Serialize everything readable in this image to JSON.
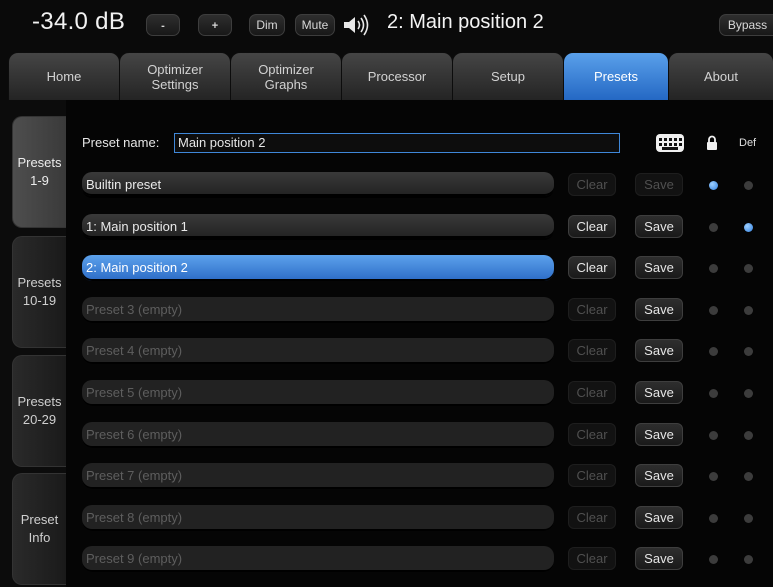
{
  "header": {
    "volume": "-34.0 dB",
    "minus_label": "-",
    "plus_label": "+",
    "dim_label": "Dim",
    "mute_label": "Mute",
    "current_preset": "2: Main position 2",
    "bypass_label": "Bypass"
  },
  "tabs": [
    {
      "label": "Home"
    },
    {
      "label": "Optimizer\nSettings"
    },
    {
      "label": "Optimizer\nGraphs"
    },
    {
      "label": "Processor"
    },
    {
      "label": "Setup"
    },
    {
      "label": "Presets",
      "active": true
    },
    {
      "label": "About"
    }
  ],
  "side_tabs": [
    {
      "label": "Presets\n1-9",
      "active": true
    },
    {
      "label": "Presets\n10-19"
    },
    {
      "label": "Presets\n20-29"
    },
    {
      "label": "Preset\nInfo"
    }
  ],
  "preset_panel": {
    "name_label": "Preset name:",
    "name_value": "Main position 2",
    "lock_column_icon": "lock-icon",
    "keyboard_icon": "keyboard-icon",
    "def_header": "Def",
    "clear_label": "Clear",
    "save_label": "Save"
  },
  "presets": [
    {
      "name": "Builtin preset",
      "state": "builtin",
      "clear_enabled": false,
      "save_enabled": false,
      "locked": true,
      "default": false
    },
    {
      "name": "1: Main position 1",
      "state": "saved",
      "clear_enabled": true,
      "save_enabled": true,
      "locked": false,
      "default": true
    },
    {
      "name": "2: Main position 2",
      "state": "selected",
      "clear_enabled": true,
      "save_enabled": true,
      "locked": false,
      "default": false
    },
    {
      "name": "Preset 3 (empty)",
      "state": "empty",
      "clear_enabled": false,
      "save_enabled": true,
      "locked": false,
      "default": false
    },
    {
      "name": "Preset 4 (empty)",
      "state": "empty",
      "clear_enabled": false,
      "save_enabled": true,
      "locked": false,
      "default": false
    },
    {
      "name": "Preset 5 (empty)",
      "state": "empty",
      "clear_enabled": false,
      "save_enabled": true,
      "locked": false,
      "default": false
    },
    {
      "name": "Preset 6 (empty)",
      "state": "empty",
      "clear_enabled": false,
      "save_enabled": true,
      "locked": false,
      "default": false
    },
    {
      "name": "Preset 7 (empty)",
      "state": "empty",
      "clear_enabled": false,
      "save_enabled": true,
      "locked": false,
      "default": false
    },
    {
      "name": "Preset 8 (empty)",
      "state": "empty",
      "clear_enabled": false,
      "save_enabled": true,
      "locked": false,
      "default": false
    },
    {
      "name": "Preset 9 (empty)",
      "state": "empty",
      "clear_enabled": false,
      "save_enabled": true,
      "locked": false,
      "default": false
    }
  ],
  "colors": {
    "accent": "#3a82dc",
    "background": "#0a0a0a",
    "indicator_on": "#2f7fe0"
  }
}
